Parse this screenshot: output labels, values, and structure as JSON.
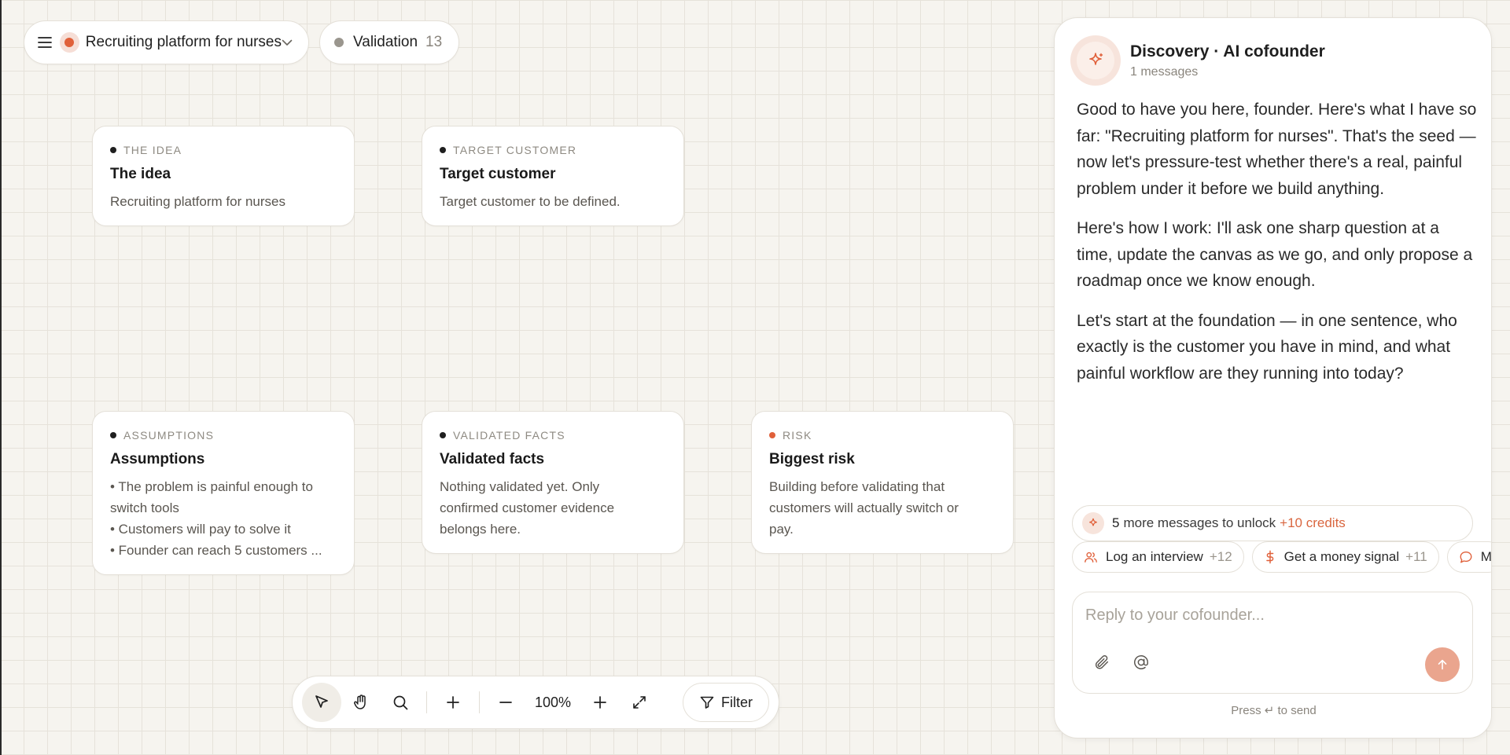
{
  "header": {
    "project_name": "Recruiting platform for nurses",
    "stage_label": "Validation",
    "stage_count": "13"
  },
  "cards": {
    "idea": {
      "kicker": "THE IDEA",
      "title": "The idea",
      "body": "Recruiting platform for nurses"
    },
    "target": {
      "kicker": "TARGET CUSTOMER",
      "title": "Target customer",
      "body": "Target customer to be defined."
    },
    "assumptions": {
      "kicker": "ASSUMPTIONS",
      "title": "Assumptions",
      "items": [
        "• The problem is painful enough to",
        "switch tools",
        "• Customers will pay to solve it",
        "• Founder can reach 5 customers ..."
      ]
    },
    "facts": {
      "kicker": "VALIDATED FACTS",
      "title": "Validated facts",
      "lines": [
        "Nothing validated yet. Only",
        "confirmed customer evidence",
        "belongs here."
      ]
    },
    "risk": {
      "kicker": "RISK",
      "title": "Biggest risk",
      "lines": [
        "Building before validating that",
        "customers will actually switch or",
        "pay."
      ]
    }
  },
  "toolbar": {
    "zoom": "100%",
    "filter_label": "Filter"
  },
  "chat": {
    "title": "Discovery · AI cofounder",
    "subtitle": "1 messages",
    "messages": [
      "Good to have you here, founder. Here's what I have so far: \"Recruiting platform for nurses\". That's the seed — now let's pressure-test whether there's a real, painful problem under it before we build anything.",
      "Here's how I work: I'll ask one sharp question at a time, update the canvas as we go, and only propose a roadmap once we know enough.",
      "Let's start at the foundation — in one sentence, who exactly is the customer you have in mind, and what painful workflow are they running into today?"
    ],
    "unlock": {
      "count": "5",
      "text": "more messages to unlock",
      "credits": "+10 credits"
    },
    "chips": [
      {
        "label": "Log an interview",
        "points": "+12",
        "icon": "people-icon"
      },
      {
        "label": "Get a money signal",
        "points": "+11",
        "icon": "dollar-icon"
      },
      {
        "label": "M",
        "points": "",
        "icon": "chat-icon"
      }
    ],
    "composer_placeholder": "Reply to your cofounder...",
    "hint": "Press ↵ to send"
  },
  "colors": {
    "accent": "#e0603a",
    "send_button": "#eaa58e",
    "credits": "#d9663f"
  }
}
